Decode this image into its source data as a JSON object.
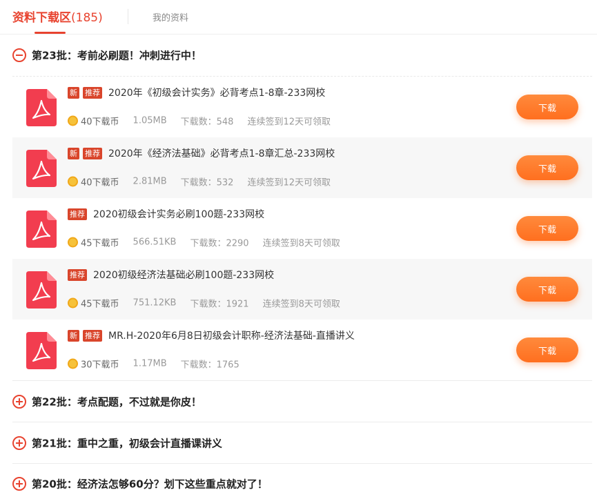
{
  "tabs": {
    "active_label": "资料下载区",
    "active_count": "(185)",
    "other_label": "我的资料"
  },
  "batches": [
    {
      "title": "第23批：考前必刷题！冲刺进行中！",
      "state": "expanded"
    },
    {
      "title": "第22批：考点配题，不过就是你皮！",
      "state": "collapsed"
    },
    {
      "title": "第21批：重中之重，初级会计直播课讲义",
      "state": "collapsed"
    },
    {
      "title": "第20批：经济法怎够60分？划下这些重点就对了！",
      "state": "collapsed"
    }
  ],
  "files": [
    {
      "tags": [
        "新",
        "推荐"
      ],
      "name": "2020年《初级会计实务》必背考点1-8章-233网校",
      "cost": "40下载币",
      "size": "1.05MB",
      "downloads": "下载数：548",
      "reward": "连续签到12天可领取",
      "button": "下载"
    },
    {
      "tags": [
        "新",
        "推荐"
      ],
      "name": "2020年《经济法基础》必背考点1-8章汇总-233网校",
      "cost": "40下载币",
      "size": "2.81MB",
      "downloads": "下载数：532",
      "reward": "连续签到12天可领取",
      "button": "下载"
    },
    {
      "tags": [
        "推荐"
      ],
      "name": "2020初级会计实务必刷100题-233网校",
      "cost": "45下载币",
      "size": "566.51KB",
      "downloads": "下载数：2290",
      "reward": "连续签到8天可领取",
      "button": "下载"
    },
    {
      "tags": [
        "推荐"
      ],
      "name": "2020初级经济法基础必刷100题-233网校",
      "cost": "45下载币",
      "size": "751.12KB",
      "downloads": "下载数：1921",
      "reward": "连续签到8天可领取",
      "button": "下载"
    },
    {
      "tags": [
        "新",
        "推荐"
      ],
      "name": "MR.H-2020年6月8日初级会计职称-经济法基础-直播讲义",
      "cost": "30下载币",
      "size": "1.17MB",
      "downloads": "下载数：1765",
      "reward": "",
      "button": "下载"
    }
  ],
  "colors": {
    "accent": "#e8432f",
    "tag_bg": "#d9452b",
    "button": "#ff7a2c",
    "coin": "#f6c23a"
  },
  "icons": {
    "pdf": "pdf-file-icon",
    "coin": "coin-icon",
    "collapse": "minus-circle-icon",
    "expand": "plus-circle-icon"
  }
}
